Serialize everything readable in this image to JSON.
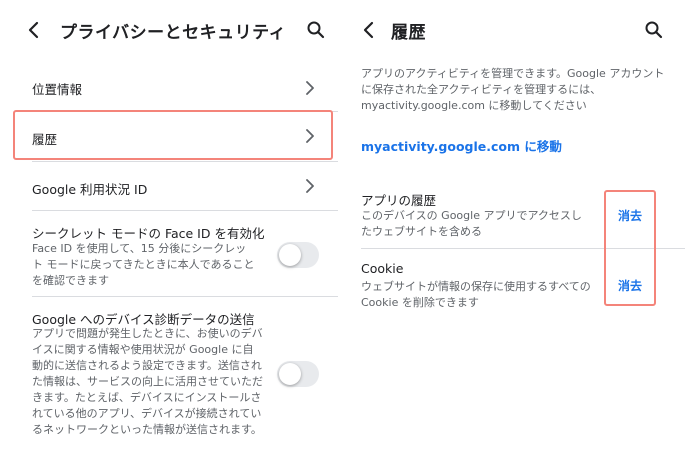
{
  "left": {
    "title": "プライバシーとセキュリティ",
    "items": [
      {
        "label": "位置情報"
      },
      {
        "label": "履歴"
      },
      {
        "label": "Google 利用状況 ID"
      }
    ],
    "face_id": {
      "title": "シークレット モードの Face ID を有効化",
      "description": "Face ID を使用して、15 分後にシークレット モードに戻ってきたときに本人であることを確認できます",
      "enabled": false
    },
    "diagnostics": {
      "title": "Google へのデバイス診断データの送信",
      "description": "アプリで問題が発生したときに、お使いのデバイスに関する情報や使用状況が Google に自動的に送信されるよう設定できます。送信された情報は、サービスの向上に活用させていただきます。たとえば、デバイスにインストールされている他のアプリ、デバイスが接続されているネットワークといった情報が送信されます。",
      "enabled": false
    }
  },
  "right": {
    "title": "履歴",
    "intro": "アプリのアクティビティを管理できます。Google アカウントに保存された全アクティビティを管理するには、myactivity.google.com に移動してください",
    "link": "myactivity.google.com に移動",
    "app_history": {
      "title": "アプリの履歴",
      "description": "このデバイスの Google アプリでアクセスしたウェブサイトを含める",
      "action": "消去"
    },
    "cookie": {
      "title": "Cookie",
      "description": "ウェブサイトが情報の保存に使用するすべての Cookie を削除できます",
      "action": "消去"
    }
  },
  "colors": {
    "accent": "#1a73e8",
    "highlight": "#f4847a",
    "divider": "#dadce0"
  }
}
